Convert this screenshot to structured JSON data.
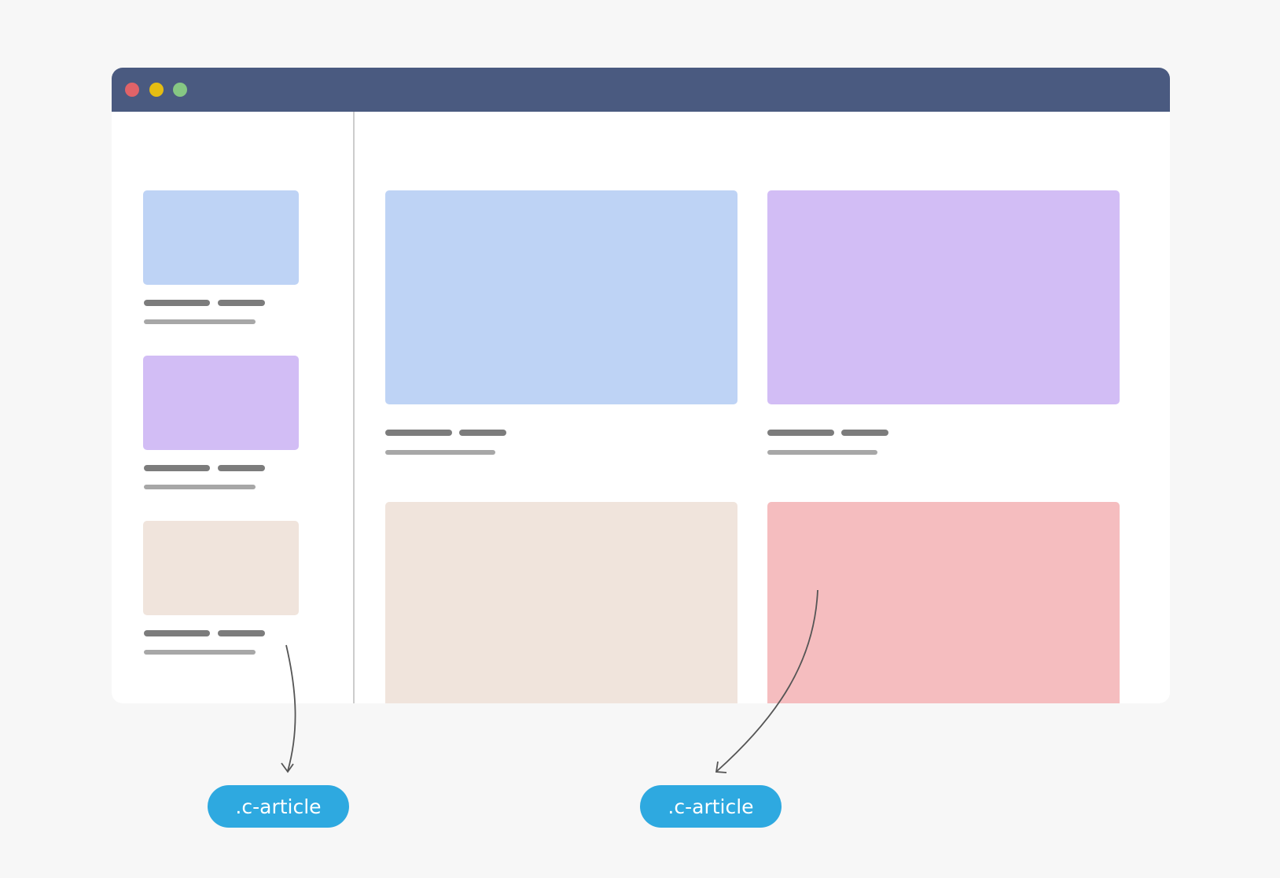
{
  "colors": {
    "background": "#f7f7f7",
    "titlebar": "#4a5a80",
    "window_dot_red": "#e06368",
    "window_dot_yellow": "#e5bd12",
    "window_dot_green": "#86c783",
    "card_blue": "#bed3f5",
    "card_purple": "#d2bdf5",
    "card_beige": "#f0e4dc",
    "card_pink": "#f5bdbf",
    "label_pill": "#2ea9e0"
  },
  "labels": {
    "left": ".c-article",
    "right": ".c-article"
  }
}
